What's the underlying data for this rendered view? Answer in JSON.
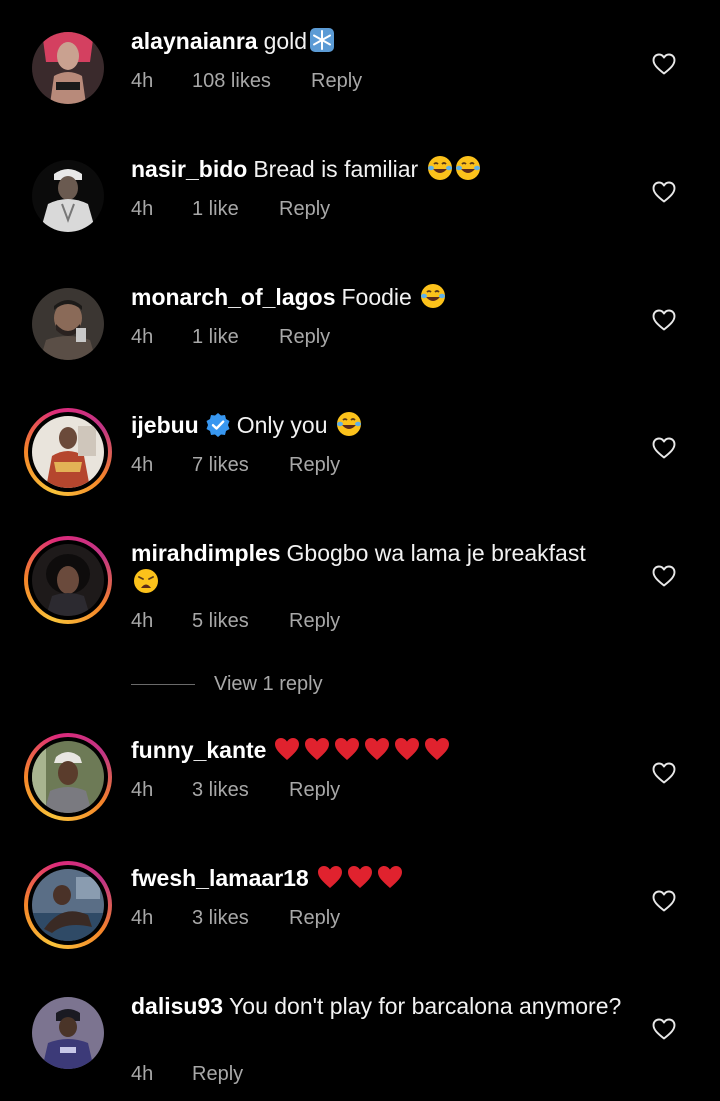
{
  "comments": [
    {
      "username": "alaynaianra",
      "text": "gold",
      "time": "4h",
      "likes": "108 likes",
      "reply": "Reply"
    },
    {
      "username": "nasir_bido",
      "text": "Bread is familiar",
      "time": "4h",
      "likes": "1 like",
      "reply": "Reply"
    },
    {
      "username": "monarch_of_lagos",
      "text": "Foodie",
      "time": "4h",
      "likes": "1 like",
      "reply": "Reply"
    },
    {
      "username": "ijebuu",
      "text": "Only you",
      "time": "4h",
      "likes": "7 likes",
      "reply": "Reply",
      "verified": true
    },
    {
      "username": "mirahdimples",
      "text": "Gbogbo wa lama je breakfast",
      "time": "4h",
      "likes": "5 likes",
      "reply": "Reply"
    },
    {
      "username": "funny_kante",
      "text": "",
      "time": "4h",
      "likes": "3 likes",
      "reply": "Reply"
    },
    {
      "username": "fwesh_lamaar18",
      "text": "",
      "time": "4h",
      "likes": "3 likes",
      "reply": "Reply"
    },
    {
      "username": "dalisu93",
      "text": "You don't play for barcalona anymore?",
      "time": "4h",
      "reply": "Reply"
    }
  ],
  "view_replies": "View 1 reply",
  "icons": {
    "like": "heart-outline-icon",
    "verified": "verified-badge-icon",
    "snowflake": "snowflake-emoji",
    "laugh": "tears-of-joy-emoji",
    "weary": "weary-face-emoji",
    "heart": "red-heart-emoji"
  },
  "colors": {
    "background": "#000000",
    "secondary_text": "#a8a8a8",
    "verified": "#3897f0",
    "heart_emoji": "#e0222e",
    "ring_gradient": [
      "#f9c33a",
      "#f58529",
      "#dd2a7b"
    ]
  }
}
